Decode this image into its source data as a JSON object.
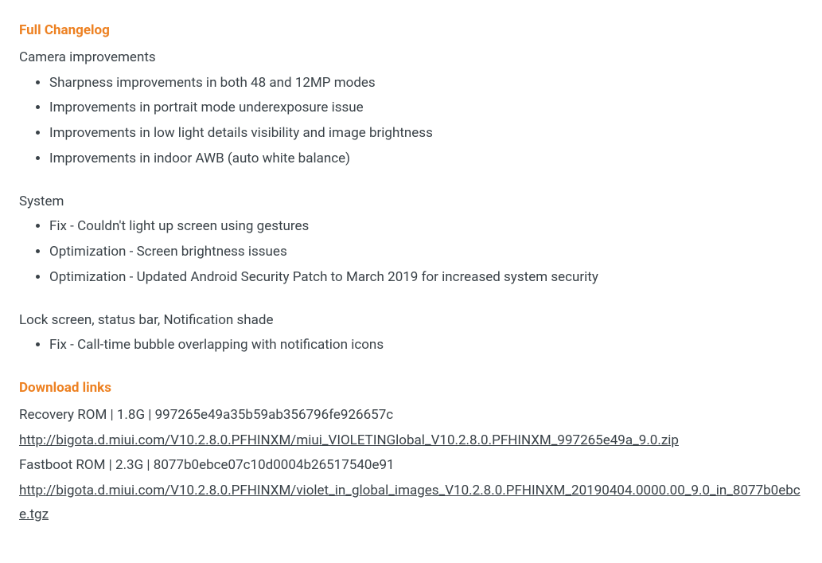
{
  "changelog": {
    "heading": "Full Changelog",
    "camera": {
      "title": "Camera improvements",
      "items": [
        "Sharpness improvements in both 48 and 12MP modes",
        "Improvements in portrait mode underexposure issue",
        "Improvements in low light details visibility and image brightness",
        "Improvements in indoor AWB (auto white balance)"
      ]
    },
    "system": {
      "title": "System",
      "items": [
        "Fix - Couldn't light up screen using gestures",
        "Optimization - Screen brightness issues",
        "Optimization - Updated Android Security Patch to March 2019 for increased system security"
      ]
    },
    "lockscreen": {
      "title": "Lock screen, status bar, Notification shade",
      "items": [
        "Fix - Call-time bubble overlapping with notification icons"
      ]
    }
  },
  "downloads": {
    "heading": "Download links",
    "recovery": {
      "label": "Recovery ROM | 1.8G | 997265e49a35b59ab356796fe926657c",
      "url": "http://bigota.d.miui.com/V10.2.8.0.PFHINXM/miui_VIOLETINGlobal_V10.2.8.0.PFHINXM_997265e49a_9.0.zip"
    },
    "fastboot": {
      "label": "Fastboot ROM | 2.3G | 8077b0ebce07c10d0004b26517540e91",
      "url": "http://bigota.d.miui.com/V10.2.8.0.PFHINXM/violet_in_global_images_V10.2.8.0.PFHINXM_20190404.0000.00_9.0_in_8077b0ebce.tgz"
    }
  }
}
